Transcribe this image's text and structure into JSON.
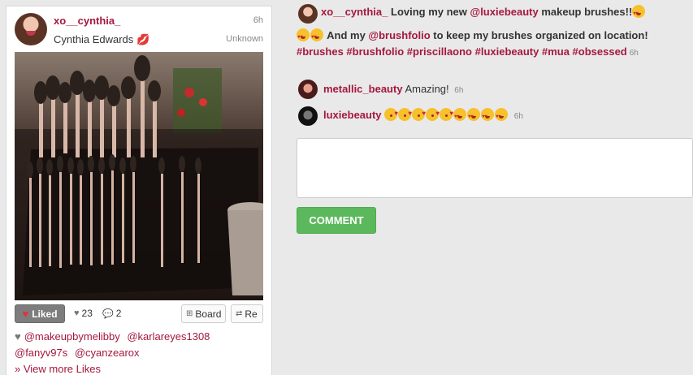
{
  "post": {
    "username": "xo__cynthia_",
    "full_name": "Cynthia Edwards",
    "time": "6h",
    "location": "Unknown",
    "liked_label": "Liked",
    "likes_count": "23",
    "comments_count": "2",
    "board_label": "Board",
    "repost_label": "Re",
    "likers": [
      "@makeupbymelibby",
      "@karlareyes1308",
      "@fanyv97s",
      "@cyanzearox"
    ],
    "view_more_label": "» View more Likes"
  },
  "caption": {
    "username": "xo__cynthia_",
    "text_1": "Loving my new ",
    "mention_1": "@luxiebeauty",
    "text_2": " makeup brushes!!",
    "text_3": " And my ",
    "mention_2": "@brushfolio",
    "text_4": " to keep my brushes organized on location! ",
    "hashtags": "#brushes #brushfolio #priscillaono #luxiebeauty #mua #obsessed",
    "time": "6h"
  },
  "comments": [
    {
      "username": "metallic_beauty",
      "text": "Amazing!",
      "time": "6h"
    },
    {
      "username": "luxiebeauty",
      "text": "",
      "time": "6h"
    }
  ],
  "comment_button_label": "Comment",
  "colors": {
    "accent": "#a5183e",
    "button_green": "#5cb85c"
  }
}
